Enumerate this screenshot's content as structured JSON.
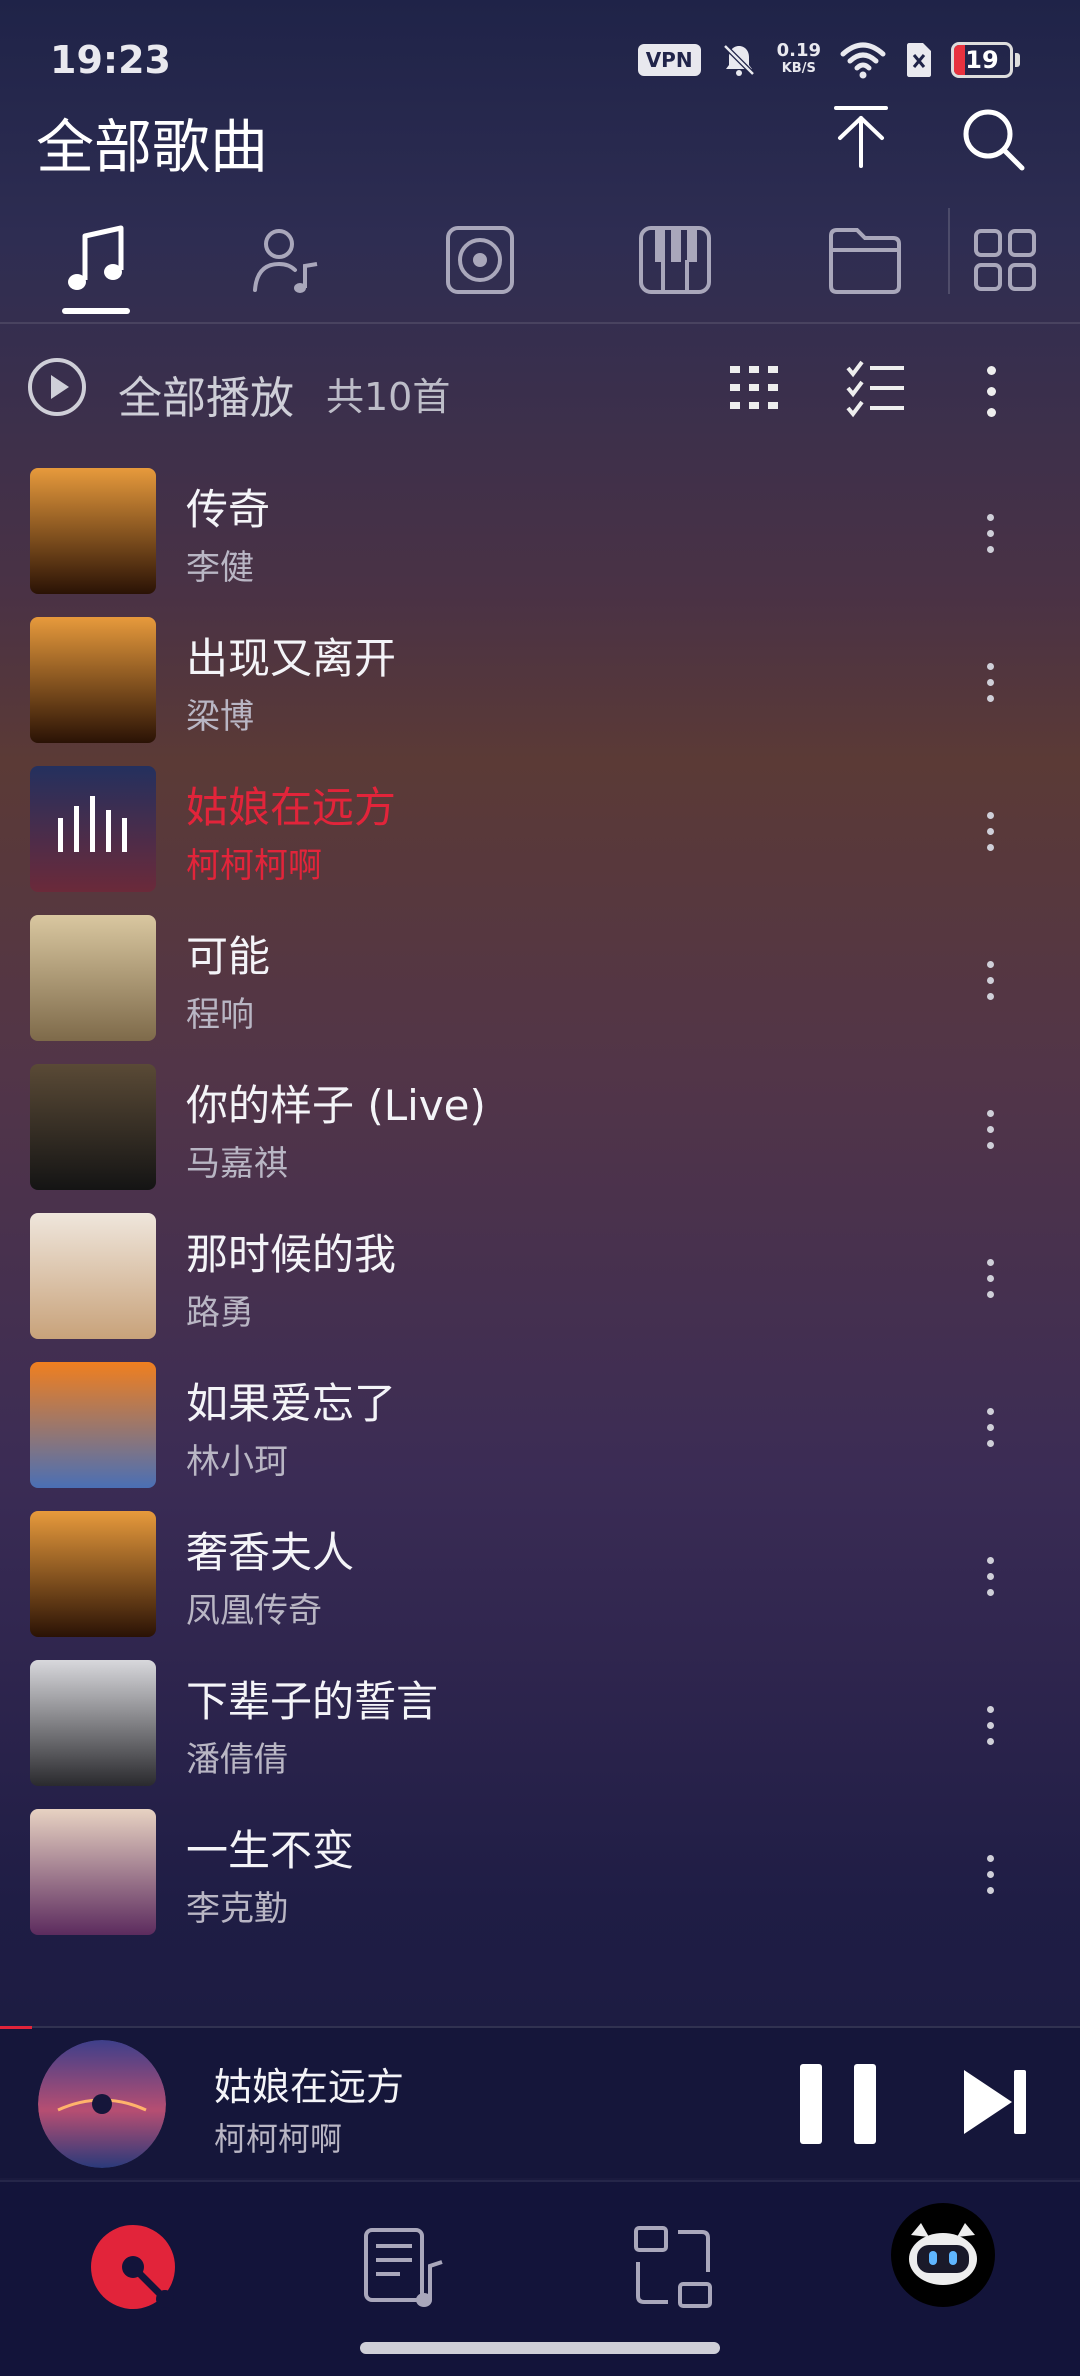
{
  "status": {
    "time": "19:23",
    "vpn": "VPN",
    "net_speed_value": "0.19",
    "net_speed_unit": "KB/S",
    "battery": "19",
    "battery_level": 0.19
  },
  "header": {
    "title": "全部歌曲"
  },
  "tabs": [
    {
      "icon": "music-note-icon"
    },
    {
      "icon": "artist-icon"
    },
    {
      "icon": "album-icon"
    },
    {
      "icon": "piano-icon"
    },
    {
      "icon": "folder-icon"
    },
    {
      "icon": "grid-icon"
    }
  ],
  "playall": {
    "label": "全部播放",
    "count": "共10首"
  },
  "songs": [
    {
      "title": "传奇",
      "artist": "李健",
      "active": false
    },
    {
      "title": "出现又离开",
      "artist": "梁博",
      "active": false
    },
    {
      "title": "姑娘在远方",
      "artist": "柯柯柯啊",
      "active": true
    },
    {
      "title": "可能",
      "artist": "程响",
      "active": false
    },
    {
      "title": "你的样子 (Live)",
      "artist": "马嘉祺",
      "active": false
    },
    {
      "title": "那时候的我",
      "artist": "路勇",
      "active": false
    },
    {
      "title": "如果爱忘了",
      "artist": "林小珂",
      "active": false
    },
    {
      "title": "奢香夫人",
      "artist": "凤凰传奇",
      "active": false
    },
    {
      "title": "下辈子的誓言",
      "artist": "潘倩倩",
      "active": false
    },
    {
      "title": "一生不变",
      "artist": "李克勤",
      "active": false
    }
  ],
  "now_playing": {
    "title": "姑娘在远方",
    "artist": "柯柯柯啊",
    "progress": 0.03
  },
  "colors": {
    "accent": "#e2243a"
  }
}
